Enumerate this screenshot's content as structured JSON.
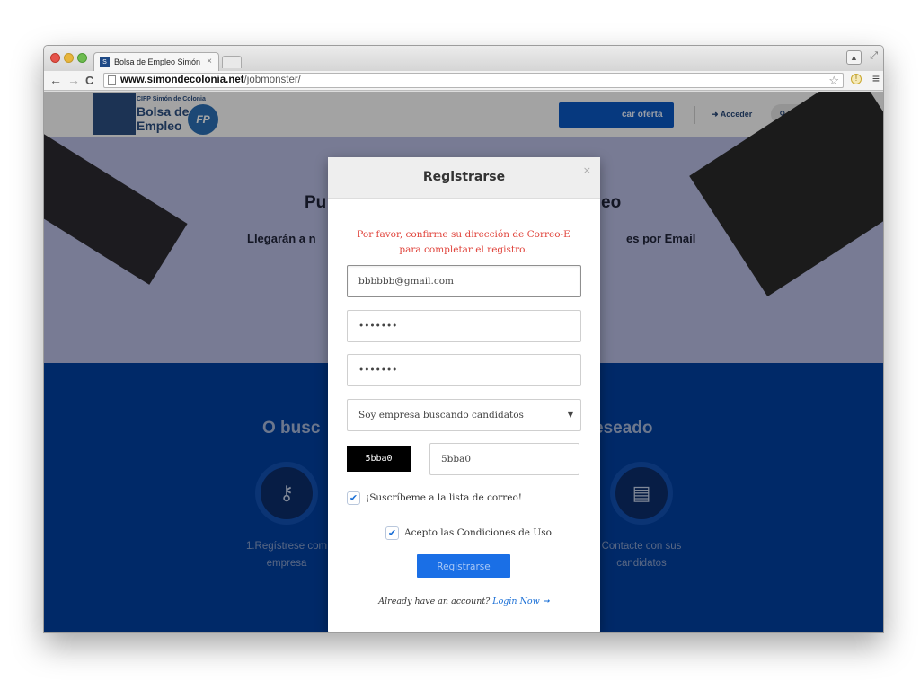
{
  "browser": {
    "tab_title": "Bolsa de Empleo Simón de",
    "tab_close": "×",
    "favicon": "S",
    "url_host": "www.simondecolonia.net",
    "url_path": "/jobmonster/",
    "icons": {
      "back": "←",
      "forward": "→",
      "reload": "C",
      "star": "☆",
      "extension": "!",
      "menu": "≡",
      "fullscreen": "⤢",
      "user": "▲"
    }
  },
  "site": {
    "logo_small": "CIFP Simón de Colonia",
    "logo_line1": "Bolsa de",
    "logo_line2": "Empleo",
    "logo_badge": "FP",
    "post_job_partial": "car oferta",
    "login": "➜ Acceder",
    "register": "⚲ Registrate",
    "hero_title_left": "Pu",
    "hero_title_right": "eo",
    "hero_sub_left": "Llegarán a n",
    "hero_sub_right": "es por Email",
    "features_head_left": "O busc",
    "features_head_right": "eseado",
    "feature_left_line1": "1.Regístrese com",
    "feature_left_line2": "empresa",
    "feature_right_line1": "Contacte con sus",
    "feature_right_line2": "candidatos",
    "feature_left_icon": "key-icon",
    "feature_right_icon": "document-icon"
  },
  "modal": {
    "title": "Registrarse",
    "close": "×",
    "notice": "Por favor, confirme su dirección de Correo-E para completar el registro.",
    "email_value": "bbbbbb@gmail.com",
    "password_value": "•••••••",
    "password_confirm_value": "•••••••",
    "role_value": "Soy empresa buscando candidatos",
    "captcha_text": "5bba0",
    "captcha_value": "5bba0",
    "newsletter_label": "¡Suscríbeme a la lista de correo!",
    "newsletter_checked": true,
    "terms_label": "Acepto las Condiciones de Uso",
    "terms_checked": true,
    "check_glyph": "✔",
    "submit": "Registrarse",
    "footer_text": "Already have an account?",
    "footer_link": "Login Now ➞"
  },
  "colors": {
    "accent": "#1a6fe6",
    "error": "#e0443c",
    "features_bg": "#013fa0"
  }
}
